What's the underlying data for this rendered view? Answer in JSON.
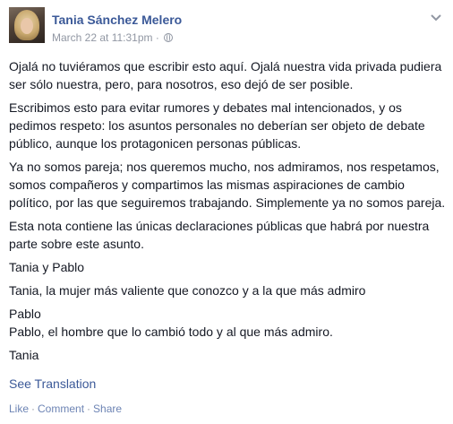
{
  "post": {
    "author": "Tania Sánchez Melero",
    "timestamp": "March 22 at 11:31pm",
    "meta_separator": "·",
    "privacy_icon": "globe-icon",
    "menu_icon": "chevron-down-icon",
    "paragraphs": [
      "Ojalá no tuviéramos que escribir esto aquí. Ojalá nuestra vida privada pudiera ser sólo nuestra, pero, para nosotros, eso dejó de ser posible.",
      "Escribimos esto para evitar rumores y debates mal intencionados, y os pedimos respeto: los asuntos personales no deberían ser objeto de debate público, aunque los protagonicen personas públicas.",
      "Ya no somos pareja; nos queremos mucho, nos admiramos, nos respetamos, somos compañeros y compartimos las mismas aspiraciones de cambio político, por las que seguiremos trabajando. Simplemente ya no somos pareja.",
      "Esta nota contiene las únicas declaraciones públicas que habrá por nuestra parte sobre este asunto.",
      "Tania y Pablo",
      "Tania, la mujer más valiente que conozco y a la que más admiro",
      "Pablo",
      "Pablo, el hombre que lo cambió todo y al que más admiro.",
      "Tania"
    ],
    "see_translation": "See Translation",
    "actions": {
      "like": "Like",
      "comment": "Comment",
      "share": "Share",
      "separator": "·"
    }
  },
  "colors": {
    "link": "#3b5998",
    "meta": "#9197a3",
    "text": "#141823"
  }
}
